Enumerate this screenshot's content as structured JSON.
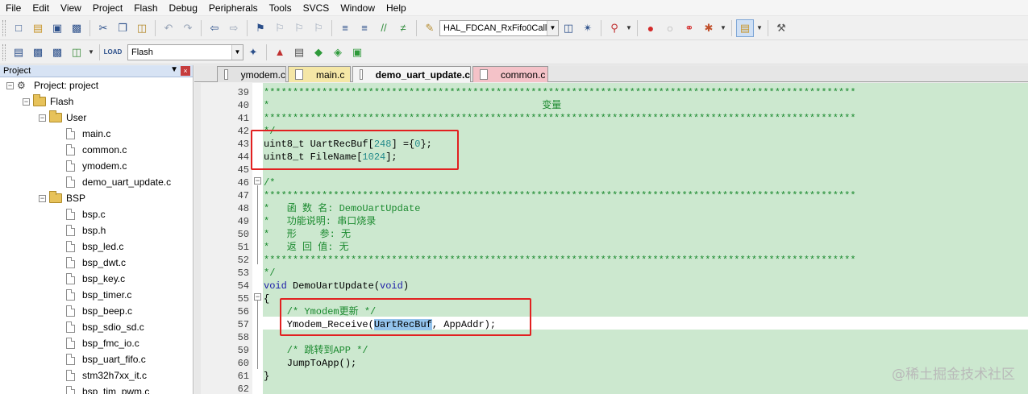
{
  "menu": [
    "File",
    "Edit",
    "View",
    "Project",
    "Flash",
    "Debug",
    "Peripherals",
    "Tools",
    "SVCS",
    "Window",
    "Help"
  ],
  "toolbar": {
    "function_combo": "HAL_FDCAN_RxFifo0Callb",
    "target_combo": "Flash"
  },
  "project_panel": {
    "title": "Project",
    "pin": "p",
    "close": "×",
    "root": "Project: project",
    "target": "Flash",
    "groups": [
      {
        "name": "User",
        "files": [
          "main.c",
          "common.c",
          "ymodem.c",
          "demo_uart_update.c"
        ]
      },
      {
        "name": "BSP",
        "files": [
          "bsp.c",
          "bsp.h",
          "bsp_led.c",
          "bsp_dwt.c",
          "bsp_key.c",
          "bsp_timer.c",
          "bsp_beep.c",
          "bsp_sdio_sd.c",
          "bsp_fmc_io.c",
          "bsp_uart_fifo.c",
          "stm32h7xx_it.c",
          "bsp_tim_pwm.c"
        ]
      }
    ]
  },
  "tabs": [
    {
      "label": "ymodem.c",
      "color": "#e2e2e2"
    },
    {
      "label": "main.c",
      "color": "#f5e7a6"
    },
    {
      "label": "demo_uart_update.c",
      "color": "#f4f4f4"
    },
    {
      "label": "common.c",
      "color": "#f4c2c8"
    }
  ],
  "code": {
    "line_numbers": [
      "39",
      "40",
      "41",
      "42",
      "43",
      "44",
      "45",
      "46",
      "47",
      "48",
      "49",
      "50",
      "51",
      "52",
      "53",
      "54",
      "55",
      "56",
      "57",
      "58",
      "59",
      "60",
      "61",
      "62"
    ],
    "stars_row": "******************************************************************************************************",
    "l40_prefix": "*",
    "l40_title": "变量",
    "l42": "*/",
    "l43_a": "uint8_t UartRecBuf",
    "l43_b": "[",
    "l43_num": "248",
    "l43_c": "] ={",
    "l43_num2": "0",
    "l43_d": "};",
    "l44_a": "uint8_t FileName",
    "l44_b": "[",
    "l44_num": "1024",
    "l44_c": "];",
    "l46": "/*",
    "l48": "*   函 数 名: DemoUartUpdate",
    "l49": "*   功能说明: 串口烧录",
    "l50": "*   形    参: 无",
    "l51": "*   返 回 值: 无",
    "l53": "*/",
    "l54_kw": "void",
    "l54_mid": " DemoUartUpdate(",
    "l54_kw2": "void",
    "l54_end": ")",
    "l55": "{",
    "l56": "    /* Ymodem更新 */",
    "l57_a": "    Ymodem_Receive(",
    "l57_hl": "UartRecBuf",
    "l57_b": ", AppAddr);",
    "l59": "    /* 跳转到APP */",
    "l60": "    JumpToApp();",
    "l61": "}"
  },
  "watermark": "@稀土掘金技术社区"
}
